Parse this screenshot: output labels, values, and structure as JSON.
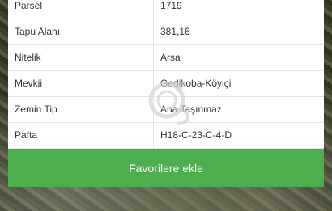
{
  "details": {
    "rows": [
      {
        "key": "Parsel",
        "value": "1719"
      },
      {
        "key": "Tapu Alanı",
        "value": "381,16"
      },
      {
        "key": "Nitelik",
        "value": "Arsa"
      },
      {
        "key": "Mevkii",
        "value": "Gedikoba-Köyiçi"
      },
      {
        "key": "Zemin Tip",
        "value": "Ana Taşınmaz"
      },
      {
        "key": "Pafta",
        "value": "H18-C-23-C-4-D"
      }
    ]
  },
  "actions": {
    "favorite_label": "Favorilere ekle",
    "button_color": "#4cae4c"
  },
  "watermark": {
    "icon": "watermark-logo-icon"
  }
}
